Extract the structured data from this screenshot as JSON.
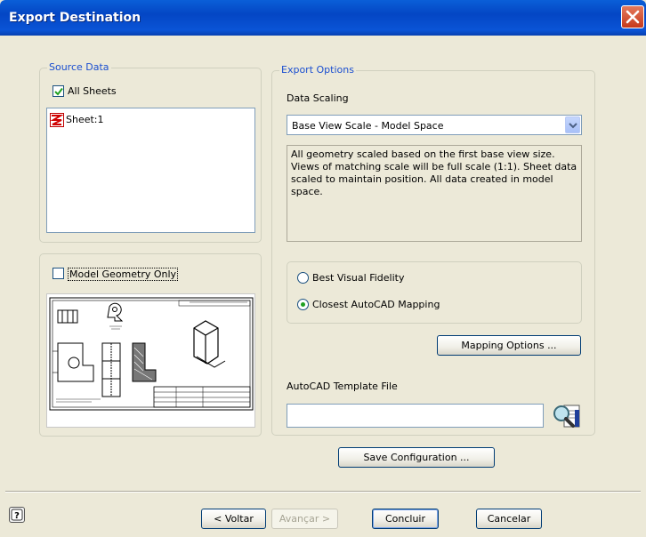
{
  "window": {
    "title": "Export Destination"
  },
  "source_data": {
    "legend": "Source Data",
    "all_sheets_label": "All Sheets",
    "all_sheets_checked": true,
    "sheets": [
      {
        "label": "Sheet:1"
      }
    ]
  },
  "model_geometry": {
    "label": "Model Geometry Only",
    "checked": false
  },
  "export_options": {
    "legend": "Export Options",
    "data_scaling_label": "Data Scaling",
    "data_scaling_value": "Base View Scale - Model Space",
    "description": "All geometry scaled based on the first base view size. Views of matching scale will be full scale (1:1). Sheet data scaled to maintain position. All data created in model space.",
    "radio_best_visual": "Best Visual Fidelity",
    "radio_closest_autocad": "Closest AutoCAD Mapping",
    "selected_radio": "Closest AutoCAD Mapping",
    "mapping_options_button": "Mapping Options ...",
    "template_label": "AutoCAD Template File",
    "template_value": ""
  },
  "save_configuration_button": "Save Configuration ...",
  "footer": {
    "back_button": "< Voltar",
    "next_button": "Avançar >",
    "finish_button": "Concluir",
    "cancel_button": "Cancelar"
  },
  "icons": {
    "close": "close-icon",
    "help": "help-icon",
    "sheet": "sheet-icon",
    "browse": "browse-file-icon"
  }
}
